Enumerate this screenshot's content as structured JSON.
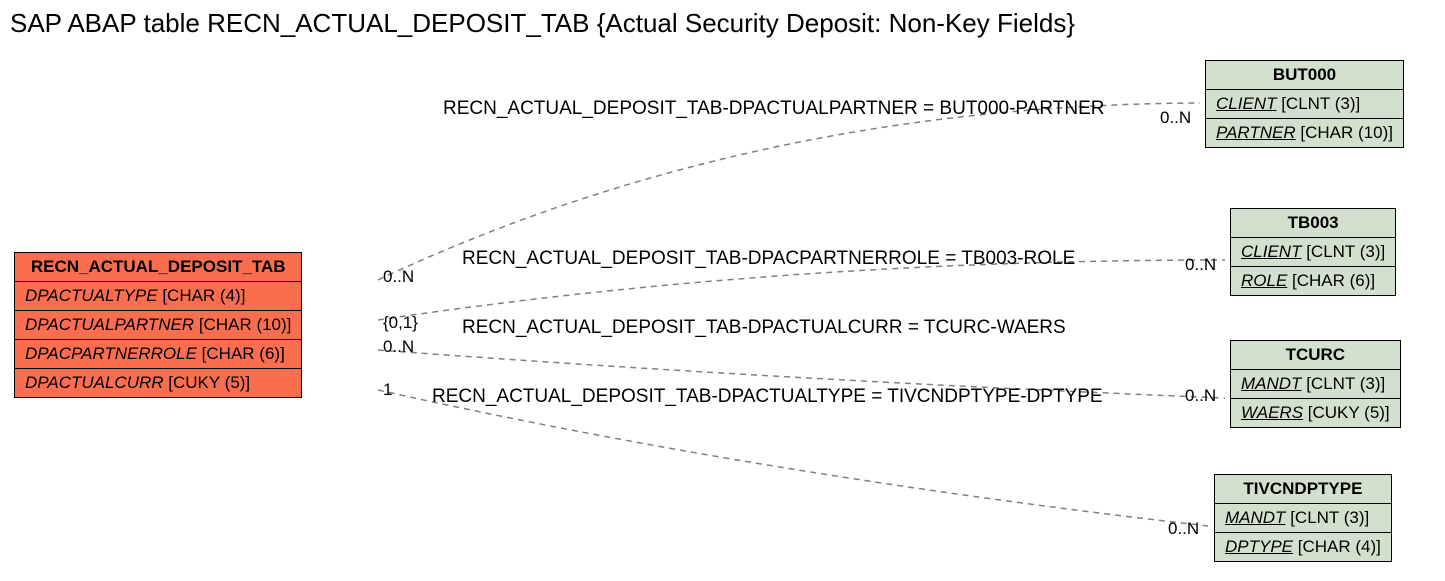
{
  "title": "SAP ABAP table RECN_ACTUAL_DEPOSIT_TAB {Actual Security Deposit: Non-Key Fields}",
  "main": {
    "name": "RECN_ACTUAL_DEPOSIT_TAB",
    "fields": [
      {
        "name": "DPACTUALTYPE",
        "type": "[CHAR (4)]"
      },
      {
        "name": "DPACTUALPARTNER",
        "type": "[CHAR (10)]"
      },
      {
        "name": "DPACPARTNERROLE",
        "type": "[CHAR (6)]"
      },
      {
        "name": "DPACTUALCURR",
        "type": "[CUKY (5)]"
      }
    ],
    "card": [
      "0..N",
      "{0,1}",
      "0..N",
      "1"
    ]
  },
  "refs": [
    {
      "name": "BUT000",
      "fields": [
        {
          "name": "CLIENT",
          "type": "[CLNT (3)]"
        },
        {
          "name": "PARTNER",
          "type": "[CHAR (10)]"
        }
      ],
      "card": "0..N",
      "rel": "RECN_ACTUAL_DEPOSIT_TAB-DPACTUALPARTNER = BUT000-PARTNER"
    },
    {
      "name": "TB003",
      "fields": [
        {
          "name": "CLIENT",
          "type": "[CLNT (3)]"
        },
        {
          "name": "ROLE",
          "type": "[CHAR (6)]"
        }
      ],
      "card": "0..N",
      "rel": "RECN_ACTUAL_DEPOSIT_TAB-DPACPARTNERROLE = TB003-ROLE"
    },
    {
      "name": "TCURC",
      "fields": [
        {
          "name": "MANDT",
          "type": "[CLNT (3)]"
        },
        {
          "name": "WAERS",
          "type": "[CUKY (5)]"
        }
      ],
      "card": "0..N",
      "rel": "RECN_ACTUAL_DEPOSIT_TAB-DPACTUALCURR = TCURC-WAERS"
    },
    {
      "name": "TIVCNDPTYPE",
      "fields": [
        {
          "name": "MANDT",
          "type": "[CLNT (3)]"
        },
        {
          "name": "DPTYPE",
          "type": "[CHAR (4)]"
        }
      ],
      "card": "0..N",
      "rel": "RECN_ACTUAL_DEPOSIT_TAB-DPACTUALTYPE = TIVCNDPTYPE-DPTYPE"
    }
  ]
}
